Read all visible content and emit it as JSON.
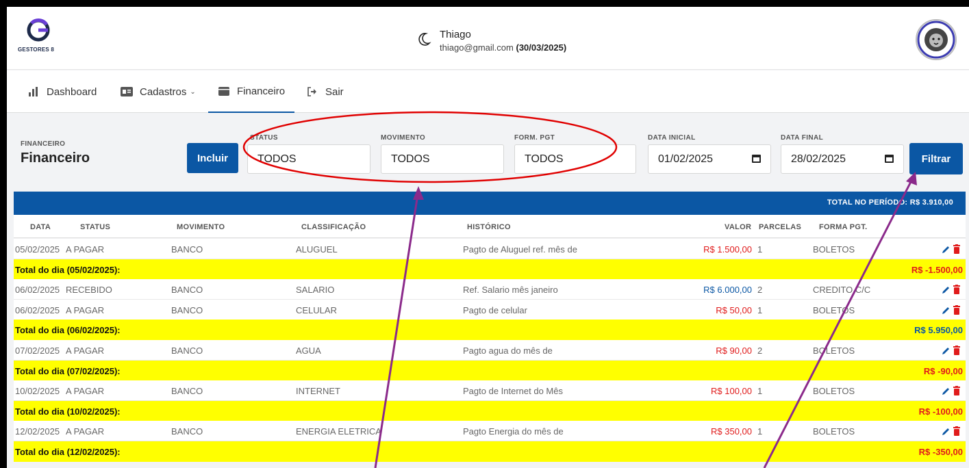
{
  "header": {
    "logo_text": "GESTORES 8",
    "user_name": "Thiago",
    "user_email": "thiago@gmail.com",
    "user_date": "(30/03/2025)"
  },
  "nav": [
    {
      "label": "Dashboard",
      "icon": "bar-chart-icon"
    },
    {
      "label": "Cadastros",
      "icon": "id-card-icon"
    },
    {
      "label": "Financeiro",
      "icon": "wallet-icon"
    },
    {
      "label": "Sair",
      "icon": "sign-out-icon"
    }
  ],
  "page": {
    "breadcrumb": "FINANCEIRO",
    "title": "Financeiro",
    "incluir_label": "Incluir",
    "filtrar_label": "Filtrar"
  },
  "filters": {
    "status": {
      "label": "STATUS",
      "value": "TODOS"
    },
    "movimento": {
      "label": "MOVIMENTO",
      "value": "TODOS"
    },
    "forma_pgt": {
      "label": "FORM. PGT",
      "value": "TODOS"
    },
    "data_inicial": {
      "label": "DATA INICIAL",
      "value": "01/02/2025"
    },
    "data_final": {
      "label": "DATA FINAL",
      "value": "28/02/2025"
    }
  },
  "table": {
    "total_periodo_label": "TOTAL NO PERÍODO: R$ 3.910,00",
    "headers": {
      "data": "DATA",
      "status": "STATUS",
      "movimento": "MOVIMENTO",
      "classificacao": "CLASSIFICAÇÃO",
      "historico": "HISTÓRICO",
      "valor": "VALOR",
      "parcelas": "PARCELAS",
      "forma_pgt": "FORMA PGT."
    },
    "rows": [
      {
        "data": "05/02/2025",
        "status": "A PAGAR",
        "movimento": "BANCO",
        "classificacao": "ALUGUEL",
        "historico": "Pagto de Aluguel ref. mês de",
        "valor": "R$ 1.500,00",
        "parcelas": "1",
        "forma_pgt": "BOLETOS"
      },
      {
        "data": "06/02/2025",
        "status": "RECEBIDO",
        "movimento": "BANCO",
        "classificacao": "SALARIO",
        "historico": "Ref. Salario mês janeiro",
        "valor": "R$ 6.000,00",
        "parcelas": "2",
        "forma_pgt": "CREDITO C/C"
      },
      {
        "data": "06/02/2025",
        "status": "A PAGAR",
        "movimento": "BANCO",
        "classificacao": "CELULAR",
        "historico": "Pagto de celular",
        "valor": "R$ 50,00",
        "parcelas": "1",
        "forma_pgt": "BOLETOS"
      },
      {
        "data": "07/02/2025",
        "status": "A PAGAR",
        "movimento": "BANCO",
        "classificacao": "AGUA",
        "historico": "Pagto agua do mês de",
        "valor": "R$ 90,00",
        "parcelas": "2",
        "forma_pgt": "BOLETOS"
      },
      {
        "data": "10/02/2025",
        "status": "A PAGAR",
        "movimento": "BANCO",
        "classificacao": "INTERNET",
        "historico": "Pagto de Internet do Mês",
        "valor": "R$ 100,00",
        "parcelas": "1",
        "forma_pgt": "BOLETOS"
      },
      {
        "data": "12/02/2025",
        "status": "A PAGAR",
        "movimento": "BANCO",
        "classificacao": "ENERGIA ELETRICA",
        "historico": "Pagto Energia do mês de",
        "valor": "R$ 350,00",
        "parcelas": "1",
        "forma_pgt": "BOLETOS"
      }
    ],
    "day_totals": [
      {
        "label": "Total do dia (05/02/2025):",
        "amount": "R$ -1.500,00"
      },
      {
        "label": "Total do dia (06/02/2025):",
        "amount": "R$ 5.950,00"
      },
      {
        "label": "Total do dia (07/02/2025):",
        "amount": "R$ -90,00"
      },
      {
        "label": "Total do dia (10/02/2025):",
        "amount": "R$ -100,00"
      },
      {
        "label": "Total do dia (12/02/2025):",
        "amount": "R$ -350,00"
      }
    ]
  },
  "colors": {
    "primary": "#0b57a4",
    "highlight": "#ffff00",
    "negative": "#e01b1b",
    "annotation_circle": "#e00000",
    "annotation_arrow": "#8b2a8b"
  }
}
